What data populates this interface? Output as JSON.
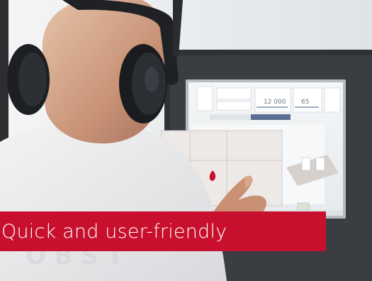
{
  "banner": {
    "title": "Quick and user-friendly"
  },
  "screen": {
    "value_main": "12 000",
    "value_secondary": "65"
  },
  "colors": {
    "accent": "#c8102e",
    "screen_bar": "#5c6f95",
    "nav_flame": "#c04bc8"
  }
}
